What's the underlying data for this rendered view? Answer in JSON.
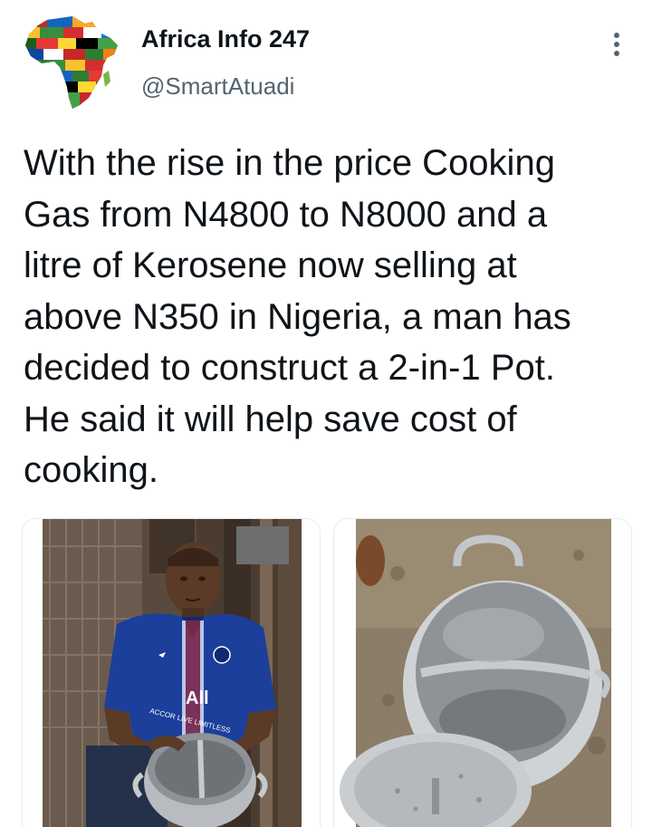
{
  "author": {
    "display_name": "Africa Info 247",
    "handle": "@SmartAtuadi",
    "avatar_icon": "africa-flags-map-icon"
  },
  "menu": {
    "icon": "more-options-icon"
  },
  "tweet": {
    "lines": [
      "With the rise in the price Cooking",
      "Gas from N4800 to N8000 and a",
      "litre of Kerosene now selling at",
      "above N350 in Nigeria, a man has",
      "decided to construct a 2-in-1 Pot.",
      "He said it will help save cost of",
      "cooking."
    ]
  },
  "media": {
    "photo_1": {
      "shirt_text": "ACCOR LIVE LIMITLESS",
      "shirt_badge": "All"
    },
    "photo_2": {}
  },
  "colors": {
    "text_primary": "#0f1419",
    "text_secondary": "#536471",
    "card_border": "#e6ecf0",
    "shirt_blue": "#1b3f9a"
  }
}
